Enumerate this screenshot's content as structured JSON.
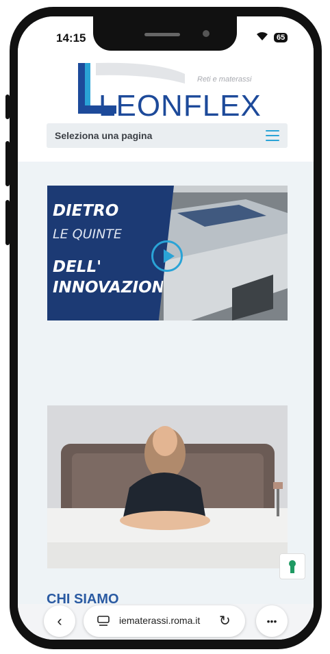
{
  "status_bar": {
    "time": "14:15",
    "battery": "65"
  },
  "site": {
    "logo_text": "LEONFLEX",
    "logo_tagline": "Reti e materassi",
    "menu_label": "Seleziona una pagina"
  },
  "video": {
    "line1": "DIETRO",
    "line2": "LE QUINTE",
    "line3": "DELL'",
    "line4": "INNOVAZIONE"
  },
  "section": {
    "heading": "CHI SIAMO"
  },
  "browser": {
    "url": "iematerassi.roma.it",
    "more": "•••"
  },
  "colors": {
    "brand_blue": "#1d4a9a",
    "accent": "#2aa3d6"
  }
}
